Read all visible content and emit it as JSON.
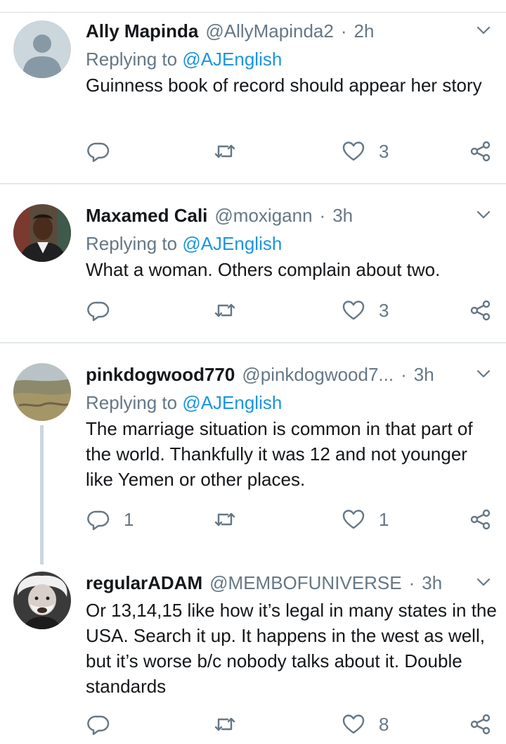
{
  "tweets": [
    {
      "name": "Ally Mapinda",
      "handle": "@AllyMapinda2",
      "time": "2h",
      "replying_prefix": "Replying to",
      "replying_to": "@AJEnglish",
      "text": "Guinness book of record should appear her story",
      "reply_count": "",
      "retweet_count": "",
      "like_count": "3"
    },
    {
      "name": "Maxamed Cali",
      "handle": "@moxigann",
      "time": "3h",
      "replying_prefix": "Replying to",
      "replying_to": "@AJEnglish",
      "text": "What a woman. Others complain about two.",
      "reply_count": "",
      "retweet_count": "",
      "like_count": "3"
    },
    {
      "name": "pinkdogwood770",
      "handle": "@pinkdogwood7...",
      "time": "3h",
      "replying_prefix": "Replying to",
      "replying_to": "@AJEnglish",
      "text": "The marriage situation is common in that part of the world. Thankfully it was 12 and not younger like Yemen or other places.",
      "reply_count": "1",
      "retweet_count": "",
      "like_count": "1"
    },
    {
      "name": "regularADAM",
      "handle": "@MEMBOFUNIVERSE",
      "time": "3h",
      "text": "Or 13,14,15 like how it’s legal in many states in the USA. Search it up. It happens in the west as well, but it’s worse b/c nobody talks about it.  Double standards",
      "reply_count": "",
      "retweet_count": "",
      "like_count": "8"
    }
  ],
  "sep_dot": "·",
  "colors": {
    "link": "#1b95e0",
    "secondary": "#657786",
    "text": "#14171a",
    "divider": "#e3e8ec",
    "thread_line": "#ccd6dd"
  },
  "icons": {
    "reply": "speech-bubble-icon",
    "retweet": "retweet-arrows-icon",
    "like": "heart-outline-icon",
    "share": "share-nodes-icon",
    "caret": "chevron-down-icon"
  }
}
